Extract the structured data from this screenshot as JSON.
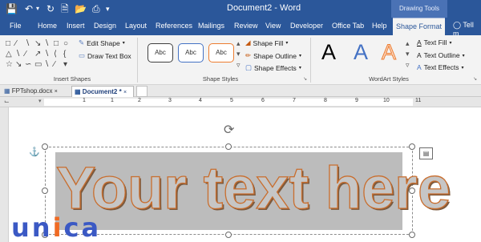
{
  "window": {
    "title": "Document2 - Word",
    "contextual_group": "Drawing Tools"
  },
  "tabs": [
    {
      "label": "File"
    },
    {
      "label": "Home"
    },
    {
      "label": "Insert"
    },
    {
      "label": "Design"
    },
    {
      "label": "Layout"
    },
    {
      "label": "References"
    },
    {
      "label": "Mailings"
    },
    {
      "label": "Review"
    },
    {
      "label": "View"
    },
    {
      "label": "Developer"
    },
    {
      "label": "Office Tab"
    },
    {
      "label": "Help"
    },
    {
      "label": "Shape Format",
      "active": true
    }
  ],
  "tell_me": "Tell m",
  "ribbon": {
    "insert_shapes": {
      "label": "Insert Shapes",
      "edit_shape": "Edit Shape",
      "draw_text_box": "Draw Text Box"
    },
    "shape_styles": {
      "label": "Shape Styles",
      "presets": [
        "Abc",
        "Abc",
        "Abc"
      ],
      "preset_colors": [
        "#404040",
        "#4472c4",
        "#ed7d31"
      ],
      "shape_fill": "Shape Fill",
      "shape_outline": "Shape Outline",
      "shape_effects": "Shape Effects"
    },
    "wordart_styles": {
      "label": "WordArt Styles",
      "letters": [
        "A",
        "A",
        "A"
      ],
      "letter_colors": [
        "#000000",
        "#4472c4",
        "#f4b183"
      ],
      "text_fill": "Text Fill",
      "text_outline": "Text Outline",
      "text_effects": "Text Effects"
    }
  },
  "doc_tabs": [
    {
      "label": "FPTshop.docx"
    },
    {
      "label": "Document2 *",
      "active": true
    }
  ],
  "ruler": {
    "numbers": [
      "1",
      "1",
      "2",
      "3",
      "4",
      "5",
      "6",
      "7",
      "8",
      "9",
      "10",
      "11"
    ]
  },
  "document": {
    "wordart_text": "Your text here"
  },
  "logo": {
    "text": "unica"
  }
}
